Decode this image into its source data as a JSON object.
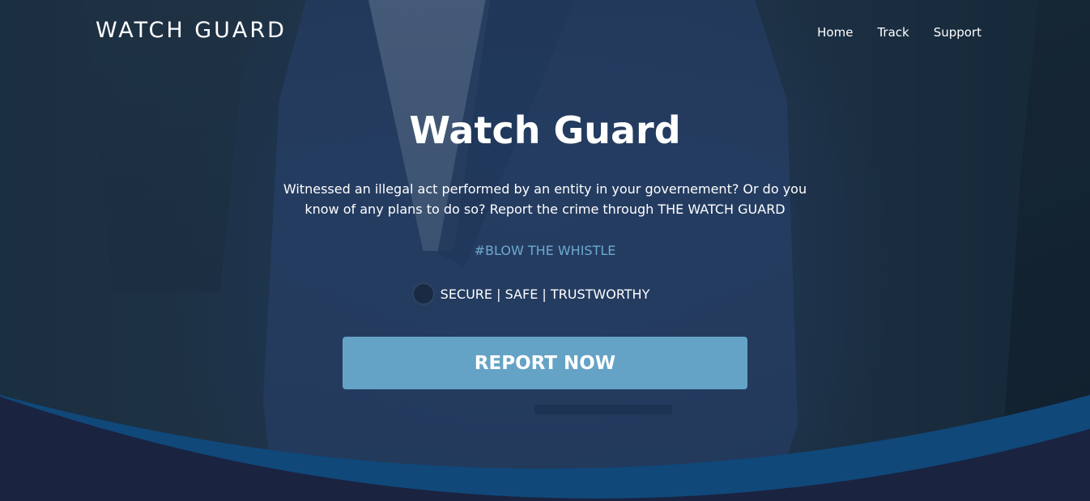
{
  "header": {
    "brand": "WATCH GUARD",
    "nav": [
      "Home",
      "Track",
      "Support"
    ]
  },
  "hero": {
    "title": "Watch Guard",
    "description": "Witnessed an illegal act performed by an entity in your governement? Or do you know of any plans to do so? Report the crime through THE WATCH GUARD",
    "hashtag": "#BLOW THE WHISTLE",
    "tagline": "SECURE | SAFE | TRUSTWORTHY",
    "cta_label": "REPORT NOW"
  },
  "colors": {
    "accent": "#64a3c6",
    "hashtag": "#6ea9cf",
    "wave_front": "#1a2340",
    "wave_back": "#10487a"
  }
}
